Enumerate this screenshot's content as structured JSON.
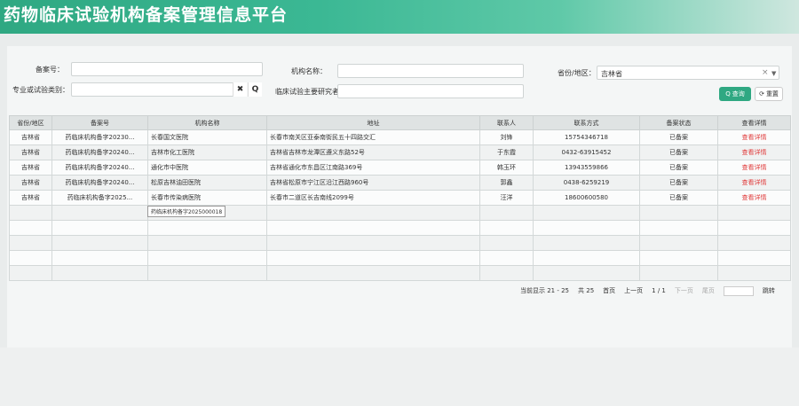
{
  "header": {
    "title": "药物临床试验机构备案管理信息平台"
  },
  "filters": {
    "record_no_label": "备案号：",
    "record_no_value": "",
    "org_name_label": "机构名称：",
    "org_name_value": "",
    "region_label": "省份/地区：",
    "region_value": "吉林省",
    "specialty_label": "专业或试验类别：",
    "specialty_value": "",
    "pi_label": "临床试验主要研究者姓名：",
    "pi_value": "",
    "clear_glyph": "✖",
    "search_glyph": "🔍",
    "select_clear_glyph": "×",
    "select_caret_glyph": "▼"
  },
  "buttons": {
    "search_label": "查询",
    "reset_label": "重置",
    "search_icon": "search-icon",
    "reset_icon": "refresh-icon",
    "search_glyph": "Q",
    "reset_glyph": "⟳"
  },
  "table": {
    "columns": [
      "省份/地区",
      "备案号",
      "机构名称",
      "地址",
      "联系人",
      "联系方式",
      "备案状态",
      "查看详情"
    ],
    "rows": [
      [
        "吉林省",
        "药临床机构备字20230...",
        "长春国文医院",
        "长春市南关区亚泰南街民五十四路交汇",
        "刘锋",
        "15754346718",
        "已备案",
        "查看详情"
      ],
      [
        "吉林省",
        "药临床机构备字20240...",
        "吉林市化工医院",
        "吉林省吉林市龙潭区遵义东路52号",
        "于东霞",
        "0432-63915452",
        "已备案",
        "查看详情"
      ],
      [
        "吉林省",
        "药临床机构备字20240...",
        "通化市中医院",
        "吉林省通化市东昌区江南路369号",
        "韩玉环",
        "13943559866",
        "已备案",
        "查看详情"
      ],
      [
        "吉林省",
        "药临床机构备字20240...",
        "松原吉林油田医院",
        "吉林省松原市宁江区沿江西路960号",
        "郭鑫",
        "0438-6259219",
        "已备案",
        "查看详情"
      ],
      [
        "吉林省",
        "药临床机构备字2025...",
        "长春市传染病医院",
        "长春市二道区长吉南线2099号",
        "汪洋",
        "18600600580",
        "已备案",
        "查看详情"
      ]
    ],
    "empty_rows": 5,
    "tooltip": "药临床机构备字2025000018"
  },
  "pager": {
    "summary": "当前显示 21 - 25",
    "total": "共 25",
    "first": "首页",
    "prev": "上一页",
    "page_info": "1 / 1",
    "next": "下一页",
    "last": "尾页",
    "jump": "跳转",
    "jump_value": ""
  }
}
